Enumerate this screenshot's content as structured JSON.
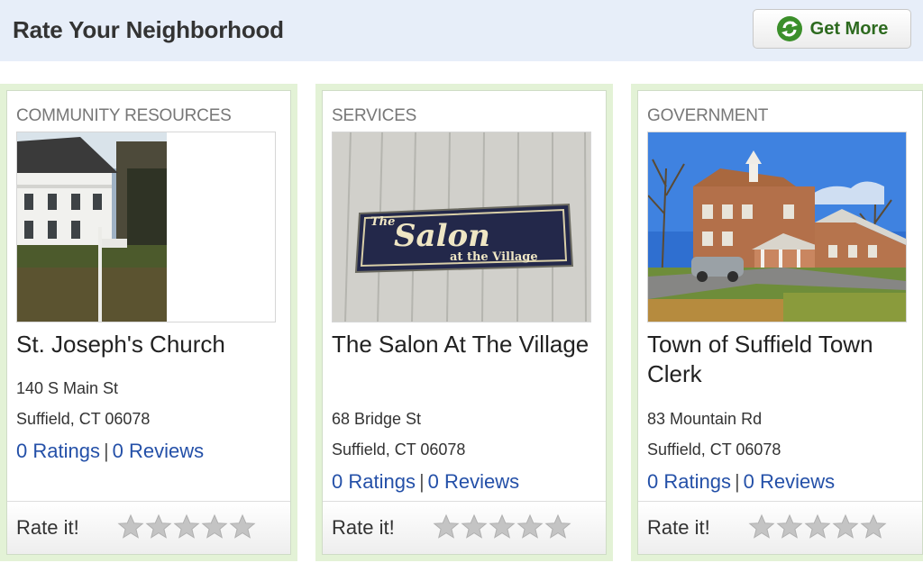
{
  "header": {
    "title": "Rate Your Neighborhood",
    "get_more_label": "Get More"
  },
  "cards": [
    {
      "category": "COMMUNITY RESOURCES",
      "name": "St. Joseph's Church",
      "address1": "140 S Main St",
      "address2": "Suffield, CT 06078",
      "ratings": "0 Ratings",
      "reviews": "0 Reviews",
      "rate_label": "Rate it!",
      "photo": "church-photo"
    },
    {
      "category": "SERVICES",
      "name": "The Salon At The Village",
      "address1": "68 Bridge St",
      "address2": "Suffield, CT 06078",
      "ratings": "0 Ratings",
      "reviews": "0 Reviews",
      "rate_label": "Rate it!",
      "photo": "salon-sign-photo",
      "sign": {
        "line1": "The",
        "line2": "Salon",
        "line3": "at the Village"
      }
    },
    {
      "category": "GOVERNMENT",
      "name": "Town of Suffield Town Clerk",
      "address1": "83 Mountain Rd",
      "address2": "Suffield, CT 06078",
      "ratings": "0 Ratings",
      "reviews": "0 Reviews",
      "rate_label": "Rate it!",
      "photo": "town-hall-photo"
    }
  ],
  "colors": {
    "header_bg": "#e7eef9",
    "card_border": "#e3f2d6",
    "link": "#2450a8",
    "get_more_text": "#2d6a1f",
    "star_empty": "#c4c4c4"
  }
}
